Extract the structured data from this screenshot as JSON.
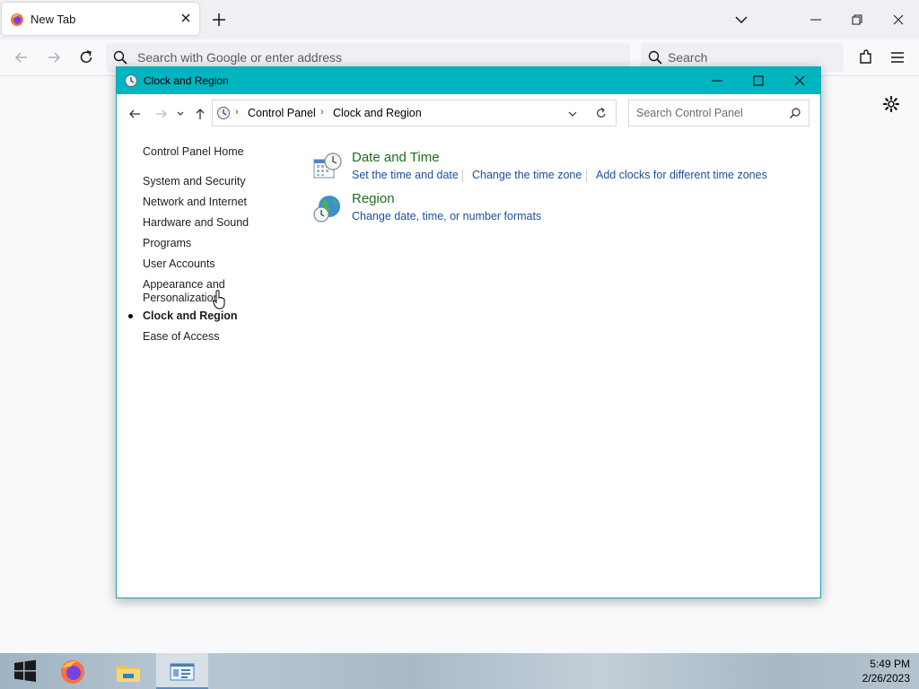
{
  "browser": {
    "tab_title": "New Tab",
    "url_placeholder": "Search with Google or enter address",
    "search_placeholder": "Search"
  },
  "window": {
    "title": "Clock and Region",
    "breadcrumb": [
      "Control Panel",
      "Clock and Region"
    ],
    "search_placeholder": "Search Control Panel"
  },
  "sidebar": {
    "items": [
      {
        "label": "Control Panel Home",
        "current": false
      },
      {
        "label": "System and Security",
        "current": false
      },
      {
        "label": "Network and Internet",
        "current": false
      },
      {
        "label": "Hardware and Sound",
        "current": false
      },
      {
        "label": "Programs",
        "current": false
      },
      {
        "label": "User Accounts",
        "current": false
      },
      {
        "label": "Appearance and Personalization",
        "current": false
      },
      {
        "label": "Clock and Region",
        "current": true
      },
      {
        "label": "Ease of Access",
        "current": false
      }
    ]
  },
  "categories": [
    {
      "title": "Date and Time",
      "icon": "calendar-clock-icon",
      "links": [
        "Set the time and date",
        "Change the time zone",
        "Add clocks for different time zones"
      ]
    },
    {
      "title": "Region",
      "icon": "globe-clock-icon",
      "links": [
        "Change date, time, or number formats"
      ]
    }
  ],
  "taskbar": {
    "time": "5:49 PM",
    "date": "2/26/2023",
    "items": [
      "start-icon",
      "firefox-icon",
      "file-explorer-icon",
      "control-panel-icon"
    ]
  },
  "colors": {
    "titlebar": "#00b4c0",
    "category_title": "#1e6e1e",
    "link": "#1b4f9c"
  }
}
